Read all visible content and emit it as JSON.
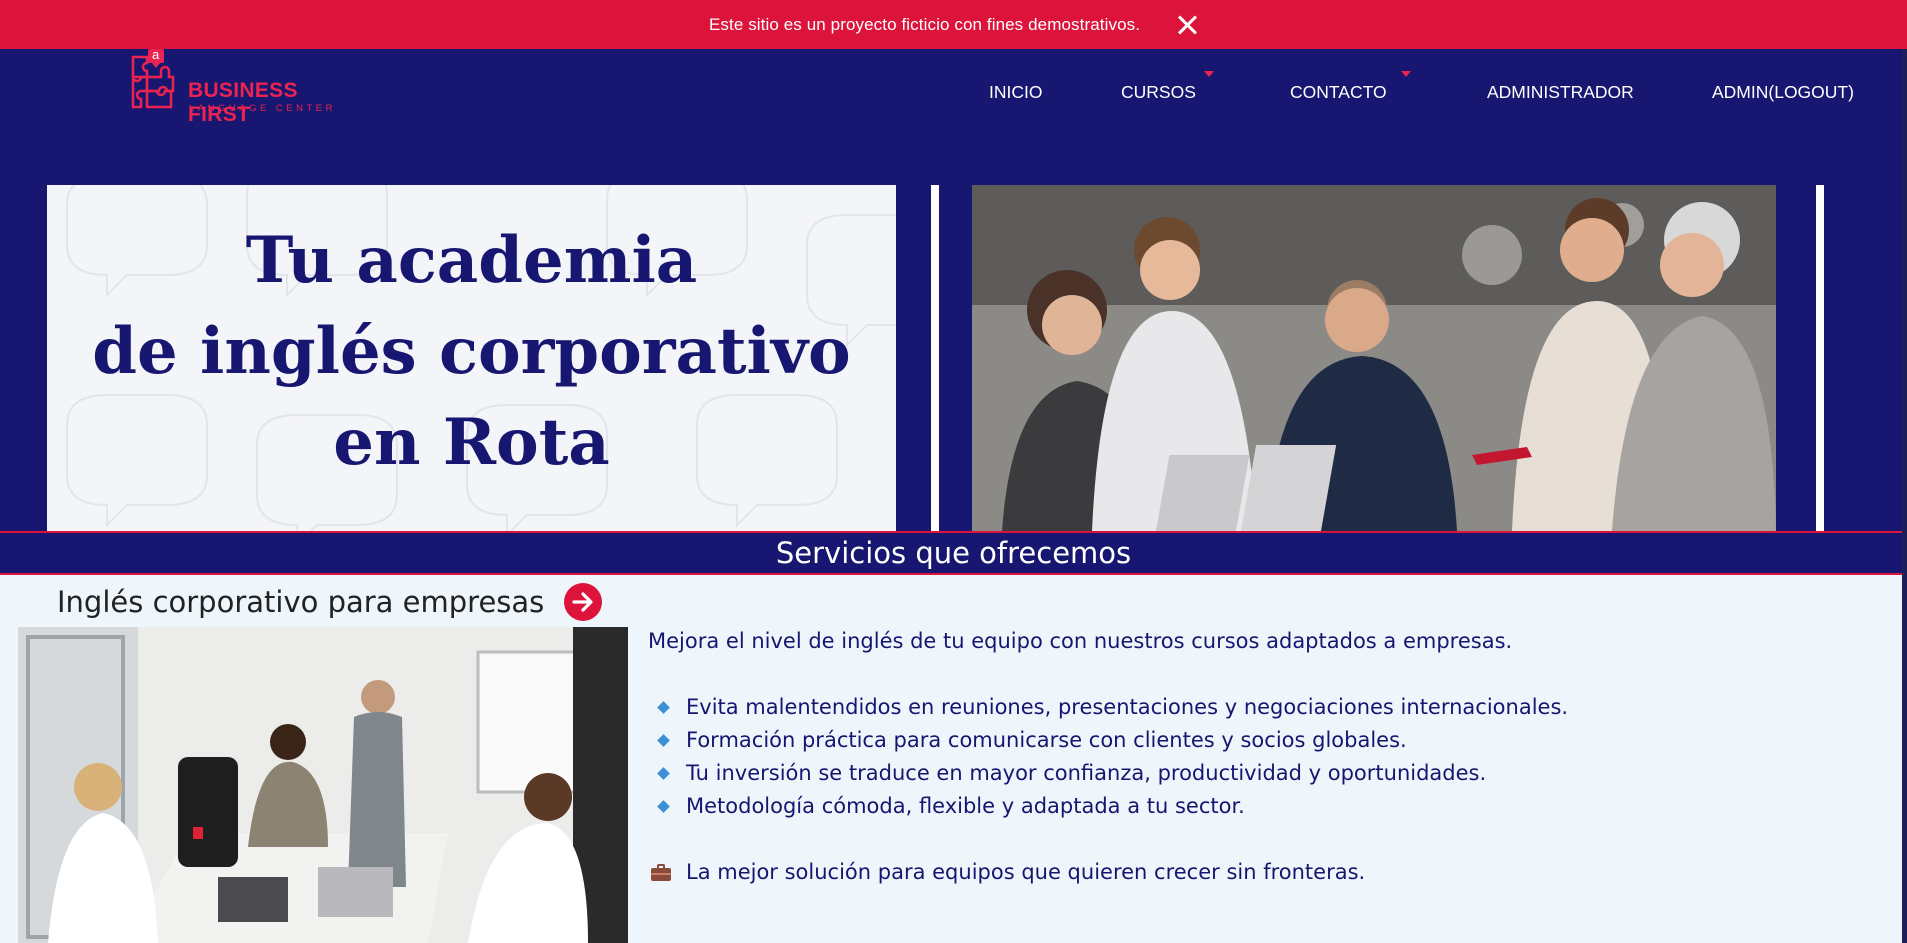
{
  "notice": {
    "text": "Este sitio es un proyecto ficticio con fines demostrativos.",
    "close_icon": "close-icon"
  },
  "brand": {
    "name": "BUSINESS FIRST",
    "tagline": "LANGUAGE CENTER",
    "badge_letter": "a",
    "color": "#ea2350"
  },
  "nav": {
    "items": [
      {
        "label": "INICIO",
        "has_dropdown": false
      },
      {
        "label": "CURSOS",
        "has_dropdown": true
      },
      {
        "label": "CONTACTO",
        "has_dropdown": true
      },
      {
        "label": "ADMINISTRADOR",
        "has_dropdown": false
      },
      {
        "label": "ADMIN(LOGOUT)",
        "has_dropdown": false
      }
    ]
  },
  "hero": {
    "title": "Tu academia\nde inglés corporativo\nen Rota"
  },
  "section": {
    "title": "Servicios que ofrecemos"
  },
  "service": {
    "title": "Inglés corporativo para empresas",
    "intro": "Mejora el nivel de inglés de tu equipo con nuestros cursos adaptados a empresas.",
    "bullets": [
      "Evita malentendidos en reuniones, presentaciones y negociaciones internacionales.",
      "Formación práctica para comunicarse con clientes y socios globales.",
      "Tu inversión se traduce en mayor confianza, productividad y oportunidades.",
      "Metodología cómoda, flexible y adaptada a tu sector."
    ],
    "closing": "La mejor solución para equipos que quieren crecer sin fronteras."
  },
  "colors": {
    "navy": "#171670",
    "crimson": "#dc143c",
    "background": "#eef6fb",
    "bullet": "#3a8fd6"
  }
}
